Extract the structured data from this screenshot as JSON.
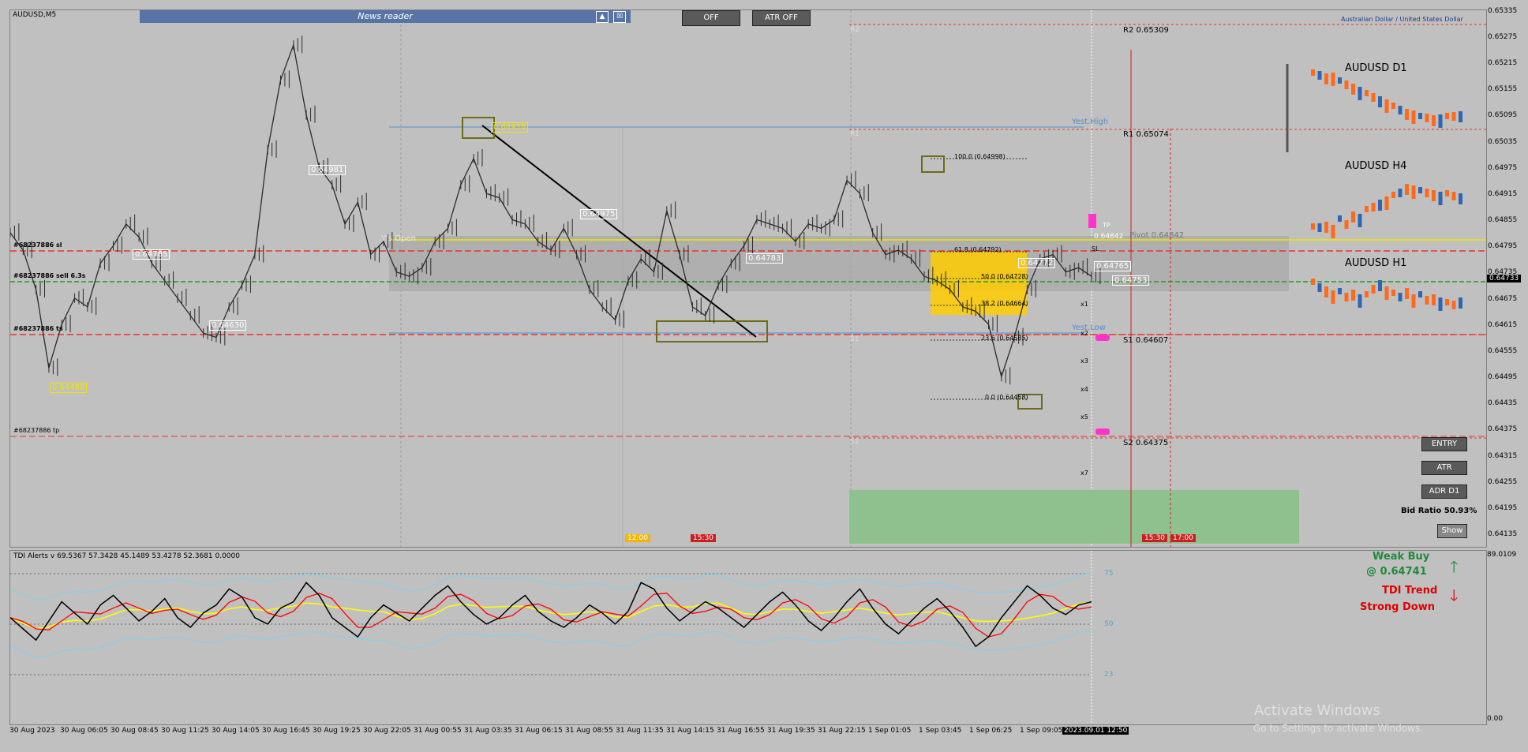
{
  "symbol": "AUDUSD,M5",
  "news_reader": {
    "label": "News reader",
    "up_icon": "▲",
    "close_icon": "☒"
  },
  "buttons": {
    "off": "OFF",
    "atr_off": "ATR OFF",
    "entry": "ENTRY",
    "atr": "ATR",
    "adr": "ADR D1",
    "show": "Show"
  },
  "pair_name": "Australian Dollar / United States Dollar",
  "pivots": {
    "r2": "R2 0.65309",
    "r1": "R1 0.65074",
    "pivot": "Pivot 0.64842",
    "s1": "S1 0.64607",
    "s2": "S2 0.64375",
    "r2_short": "R2",
    "r1_short": "R1",
    "s1_short": "S1",
    "s2_short": "S2"
  },
  "labels": {
    "yest_high": "Yest.High",
    "yest_low": "Yest.Low",
    "ys_open": "Y's Open",
    "order_sl": "#68237886 sl",
    "order_sell": "#68237886 sell 6.3s",
    "order_ts": "#68237886 ts",
    "order_tp": "#68237886 tp",
    "fib100": "100.0 (0.64998)",
    "fib618": "61.8 (0.64792)",
    "fib50": "50.0 (0.64728)",
    "fib382": "38.2 (0.64664)",
    "fib236": "23.6 (0.64585)",
    "fib0": "0.0 (0.64458)",
    "p1": "0.64981",
    "p2": "0.64978",
    "p3": "0.64785",
    "p4": "0.64630",
    "p5": "0.64488",
    "p6": "0.64783",
    "p7": "0.64975",
    "p8": "0.64772",
    "p9": "0.64765",
    "p10": "0.64753",
    "p11": "0.64842",
    "x_marks": [
      "x1",
      "x2",
      "x3",
      "x4",
      "x5",
      "x7"
    ],
    "time_1200": "12:00",
    "time_1530a": "15:30",
    "time_1530b": "15:30",
    "time_1700": "17:00",
    "bid_ratio": "Bid Ratio 50.93%",
    "d1": "AUDUSD D1",
    "h4": "AUDUSD H4",
    "h1": "AUDUSD H1",
    "current_price": "0.64733",
    "sl_tag": "SL",
    "tp_tag": "TP"
  },
  "tdi": {
    "header": "TDI Alerts v 69.5367 57.3428 45.1489 53.4278 52.3681 0.0000",
    "signal1": "Weak Buy",
    "signal1_price": "@ 0.64741",
    "signal2": "TDI Trend",
    "signal3": "Strong Down",
    "lvl75": "75",
    "lvl50": "50",
    "lvl23": "23",
    "axis_top": "89.0109",
    "axis_bottom": "0.00"
  },
  "watermark": {
    "line1": "Activate Windows",
    "line2": "Go to Settings to activate Windows."
  },
  "colors": {
    "background": "#c0c0c0",
    "candle": "#2b2b2b",
    "red_level": "#e8352a",
    "green_level": "#1f9b1f",
    "yellow_level": "#f2e400",
    "blue_level": "#4f8fd0",
    "tdi_red": "#ff0000",
    "tdi_yellow": "#ffff00",
    "tdi_band": "#87ceeb",
    "fib_zone": "#ffcc00",
    "green_zone": "#8fc18f",
    "magenta": "#ff33cc"
  },
  "chart_data": {
    "type": "line",
    "title": "AUDUSD,M5",
    "price_ylim": [
      0.6411,
      0.6534
    ],
    "price_ticks": [
      "0.65335",
      "0.65275",
      "0.65215",
      "0.65155",
      "0.65095",
      "0.65035",
      "0.64975",
      "0.64915",
      "0.64855",
      "0.64795",
      "0.64735",
      "0.64675",
      "0.64615",
      "0.64555",
      "0.64495",
      "0.64435",
      "0.64375",
      "0.64315",
      "0.64255",
      "0.64195",
      "0.64135"
    ],
    "x_ticks": [
      "30 Aug 2023",
      "30 Aug 06:05",
      "30 Aug 08:45",
      "30 Aug 11:25",
      "30 Aug 14:05",
      "30 Aug 16:45",
      "30 Aug 19:25",
      "30 Aug 22:05",
      "31 Aug 00:55",
      "31 Aug 03:35",
      "31 Aug 06:15",
      "31 Aug 08:55",
      "31 Aug 11:35",
      "31 Aug 14:15",
      "31 Aug 16:55",
      "31 Aug 19:35",
      "31 Aug 22:15",
      "1 Sep 01:05",
      "1 Sep 03:45",
      "1 Sep 06:25",
      "1 Sep 09:05",
      "2023.09.01 12:50"
    ],
    "close": [
      0.6483,
      0.6479,
      0.647,
      0.6452,
      0.6462,
      0.6468,
      0.6466,
      0.6476,
      0.648,
      0.6485,
      0.6482,
      0.6476,
      0.6472,
      0.6468,
      0.6464,
      0.646,
      0.6459,
      0.6466,
      0.6471,
      0.6478,
      0.6502,
      0.6518,
      0.6526,
      0.651,
      0.6498,
      0.6494,
      0.6485,
      0.649,
      0.6478,
      0.6481,
      0.6474,
      0.6473,
      0.6475,
      0.6481,
      0.6484,
      0.6494,
      0.65,
      0.6492,
      0.6491,
      0.6486,
      0.6485,
      0.6481,
      0.6479,
      0.6484,
      0.6478,
      0.647,
      0.6466,
      0.6463,
      0.6472,
      0.6477,
      0.6474,
      0.6488,
      0.6478,
      0.6466,
      0.6464,
      0.6471,
      0.6476,
      0.648,
      0.6486,
      0.6485,
      0.6484,
      0.6481,
      0.6485,
      0.6484,
      0.6486,
      0.6495,
      0.6492,
      0.6483,
      0.6478,
      0.6479,
      0.6477,
      0.6473,
      0.6472,
      0.647,
      0.6466,
      0.6465,
      0.6462,
      0.645,
      0.6459,
      0.647,
      0.6477,
      0.6478,
      0.6474,
      0.6475,
      0.6473
    ],
    "series": [
      {
        "name": "TDI",
        "values": [
          52,
          45,
          38,
          50,
          62,
          55,
          48,
          60,
          66,
          58,
          50,
          56,
          64,
          52,
          46,
          55,
          60,
          70,
          65,
          52,
          48,
          58,
          62,
          74,
          66,
          52,
          46,
          40,
          52,
          60,
          55,
          50,
          58,
          66,
          72,
          62,
          54,
          48,
          52,
          60,
          66,
          56,
          50,
          46,
          52,
          60,
          55,
          48,
          56,
          74,
          70,
          58,
          50,
          56,
          62,
          58,
          52,
          46,
          54,
          62,
          68,
          60,
          50,
          44,
          52,
          62,
          70,
          58,
          48,
          42,
          50,
          58,
          64,
          56,
          46,
          34,
          40,
          52,
          62,
          72,
          66,
          58,
          54,
          60,
          62
        ]
      }
    ]
  }
}
